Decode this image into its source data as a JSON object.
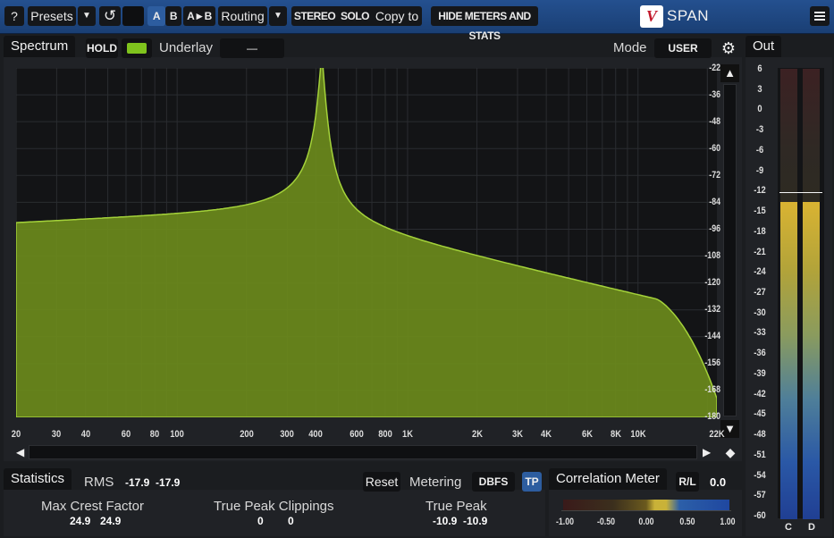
{
  "app": {
    "brand": "SPAN"
  },
  "toolbar": {
    "help": "?",
    "presets": "Presets",
    "dropdown_arrow": "▼",
    "undo": "↺",
    "a": "A",
    "b": "B",
    "a_to_b": "A►B",
    "routing": "Routing",
    "stereo": "STEREO",
    "solo": "SOLO",
    "copy_to": "Copy to",
    "hide_meters": "HIDE METERS AND STATS"
  },
  "spectrum": {
    "tab": "Spectrum",
    "hold": "HOLD",
    "underlay_label": "Underlay",
    "underlay_value": "—",
    "mode_label": "Mode",
    "mode_value": "USER",
    "y_ticks": [
      "-22",
      "-36",
      "-48",
      "-60",
      "-72",
      "-84",
      "-96",
      "-108",
      "-120",
      "-132",
      "-144",
      "-156",
      "-168",
      "-180"
    ],
    "x_ticks": [
      "20",
      "30",
      "40",
      "60",
      "80",
      "100",
      "200",
      "300",
      "400",
      "600",
      "800",
      "1K",
      "2K",
      "3K",
      "4K",
      "6K",
      "8K",
      "10K",
      "22K"
    ],
    "colors": {
      "fill": "#6b8a1c",
      "stroke": "#a4d23a",
      "hold_led": "#7fc31d"
    }
  },
  "output": {
    "tab": "Out",
    "ticks": [
      "6",
      "3",
      "0",
      "-3",
      "-6",
      "-9",
      "-12",
      "-15",
      "-18",
      "-21",
      "-24",
      "-27",
      "-30",
      "-33",
      "-36",
      "-39",
      "-42",
      "-45",
      "-48",
      "-51",
      "-54",
      "-57",
      "-60"
    ],
    "peak_hold": "-12",
    "level": "-15",
    "channels": [
      "C",
      "D"
    ]
  },
  "statistics": {
    "tab": "Statistics",
    "rms_label": "RMS",
    "rms_l": "-17.9",
    "rms_r": "-17.9",
    "reset": "Reset",
    "metering_label": "Metering",
    "metering_value": "DBFS",
    "tp": "TP",
    "crest_label": "Max Crest Factor",
    "crest_l": "24.9",
    "crest_r": "24.9",
    "clip_label": "True Peak Clippings",
    "clip_l": "0",
    "clip_r": "0",
    "tpeak_label": "True Peak",
    "tpeak_l": "-10.9",
    "tpeak_r": "-10.9"
  },
  "correlation": {
    "tab": "Correlation Meter",
    "mode": "R/L",
    "value": "0.0",
    "ticks": [
      "-1.00",
      "-0.50",
      "0.00",
      "0.50",
      "1.00"
    ]
  }
}
